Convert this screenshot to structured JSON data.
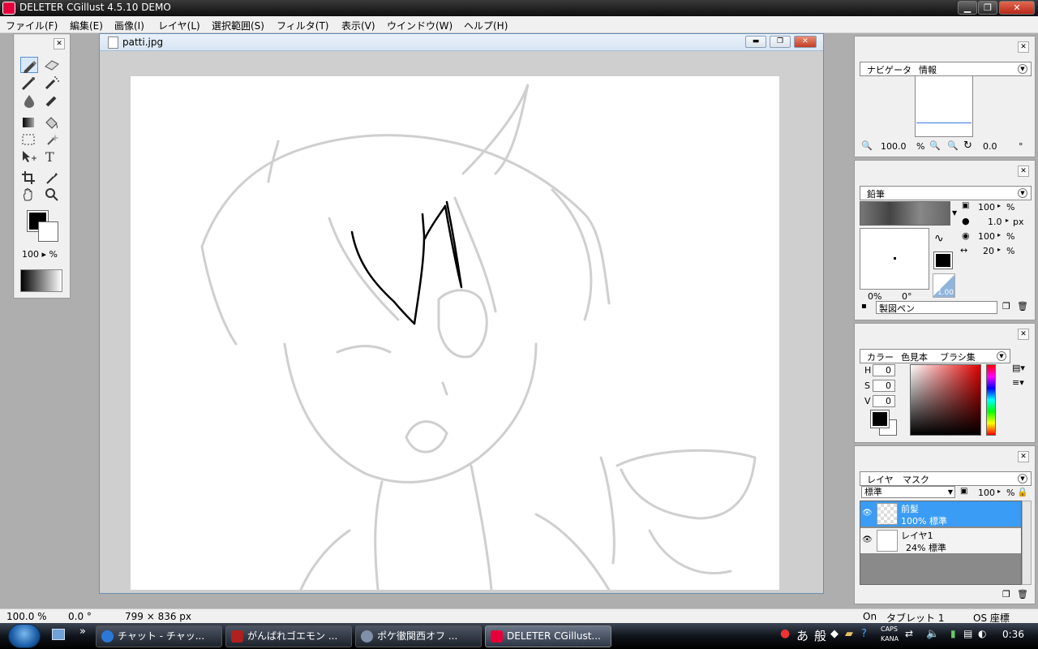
{
  "app": {
    "title": "DELETER CGillust 4.5.10 DEMO",
    "min_glyph": "▁",
    "max_glyph": "❐",
    "close_glyph": "✕"
  },
  "menu": [
    "ファイル(F)",
    "編集(E)",
    "画像(I)",
    "レイヤ(L)",
    "選択範囲(S)",
    "フィルタ(T)",
    "表示(V)",
    "ウインドウ(W)",
    "ヘルプ(H)"
  ],
  "toolbox": {
    "close_glyph": "✕",
    "opacity": "100 ▸ %"
  },
  "document": {
    "title": "patti.jpg",
    "min_glyph": "▬",
    "max_glyph": "❐",
    "close_glyph": "✕"
  },
  "navigator": {
    "tabs": [
      "ナビゲータ",
      "情報"
    ],
    "zoom": "100.0",
    "zoom_unit": "%",
    "rotation": "0.0",
    "rotation_unit": "°",
    "close_glyph": "✕"
  },
  "pen_panel": {
    "tab": "鉛筆",
    "opacity": "100",
    "opacity_unit": "%",
    "size": "1.0",
    "size_unit": "px",
    "density": "100",
    "density_unit": "%",
    "spacing": "20",
    "spacing_unit": "%",
    "angle_pct": "0%",
    "angle_deg": "0°",
    "graph_value": "1.00",
    "brush_name": "製図ペン",
    "close_glyph": "✕"
  },
  "color_panel": {
    "tabs": [
      "カラー",
      "色見本",
      "ブラシ集"
    ],
    "h_label": "H",
    "h": "0",
    "s_label": "S",
    "s": "0",
    "v_label": "V",
    "v": "0",
    "close_glyph": "✕"
  },
  "layer_panel": {
    "tabs": [
      "レイヤ",
      "マスク"
    ],
    "blend_mode": "標準",
    "opacity": "100",
    "opacity_unit": "%",
    "layers": [
      {
        "name": "前髪",
        "info": "100% 標準"
      },
      {
        "name": "レイヤ1",
        "info": "24% 標準"
      }
    ],
    "close_glyph": "✕"
  },
  "status": {
    "zoom": "100.0 %",
    "angle": "0.0 °",
    "size": "799 × 836 px",
    "on": "On",
    "tablet": "タブレット 1",
    "coord": "OS 座標"
  },
  "taskbar": {
    "quick": "»",
    "items": [
      "チャット - チャッ...",
      "がんばれゴエモン ...",
      "ポケ徹関西オフ ...",
      "DELETER CGillust..."
    ],
    "ime_a": "あ",
    "ime_mode": "般",
    "caps": "CAPS",
    "kana": "KANA",
    "clock": "0:36"
  },
  "colors": {
    "accent": "#3b9cf5",
    "fg_color": "#000000",
    "bg_color": "#ffffff"
  }
}
